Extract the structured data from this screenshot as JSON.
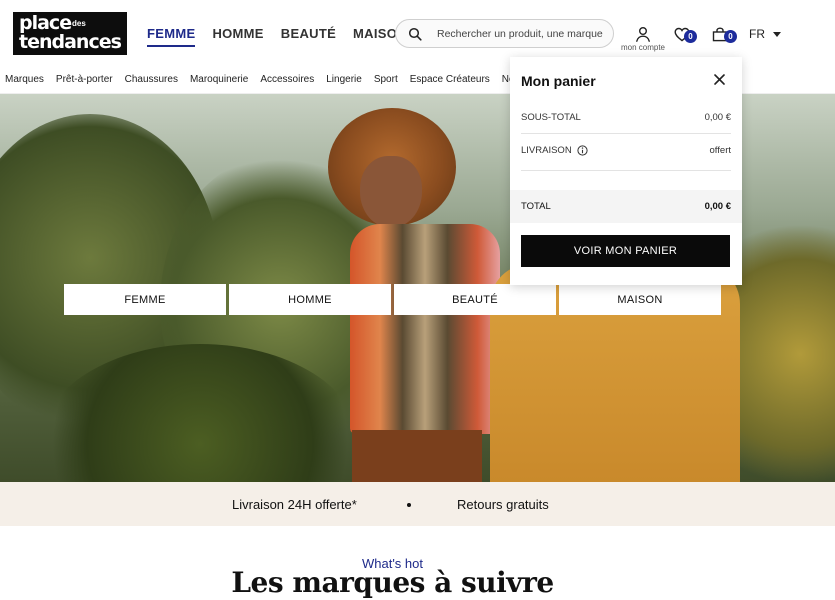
{
  "header": {
    "logo": {
      "line1": "place",
      "superscript": "des",
      "line2": "tendances"
    },
    "nav": [
      "FEMME",
      "HOMME",
      "BEAUTÉ",
      "MAISON"
    ],
    "nav_active": "FEMME",
    "search": {
      "placeholder": "Rechercher un produit, une marque"
    },
    "account_label": "mon compte",
    "wishlist_count": "0",
    "cart_count": "0",
    "language": "FR"
  },
  "subnav": {
    "items": [
      "Marques",
      "Prêt-à-porter",
      "Chaussures",
      "Maroquinerie",
      "Accessoires",
      "Lingerie",
      "Sport",
      "Espace Créateurs",
      "New"
    ]
  },
  "hero": {
    "category_buttons": [
      "FEMME",
      "HOMME",
      "BEAUTÉ",
      "MAISON"
    ]
  },
  "perks": {
    "delivery": "Livraison 24H offerte*",
    "returns": "Retours gratuits"
  },
  "section": {
    "kicker": "What's hot",
    "title": "Les marques à suivre"
  },
  "cart_panel": {
    "title": "Mon panier",
    "subtotal_label": "SOUS-TOTAL",
    "subtotal_value": "0,00 €",
    "delivery_label": "LIVRAISON",
    "delivery_value": "offert",
    "total_label": "TOTAL",
    "total_value": "0,00 €",
    "button_label": "VOIR MON PANIER"
  },
  "colors": {
    "accent": "#1e2a8a",
    "badge": "#1d2c9c",
    "perks_bg": "#f5efe8",
    "button_bg": "#0a0a0a"
  },
  "icons": [
    "search-icon",
    "user-icon",
    "heart-icon",
    "cart-icon",
    "chevron-down-icon",
    "close-icon",
    "info-icon"
  ]
}
